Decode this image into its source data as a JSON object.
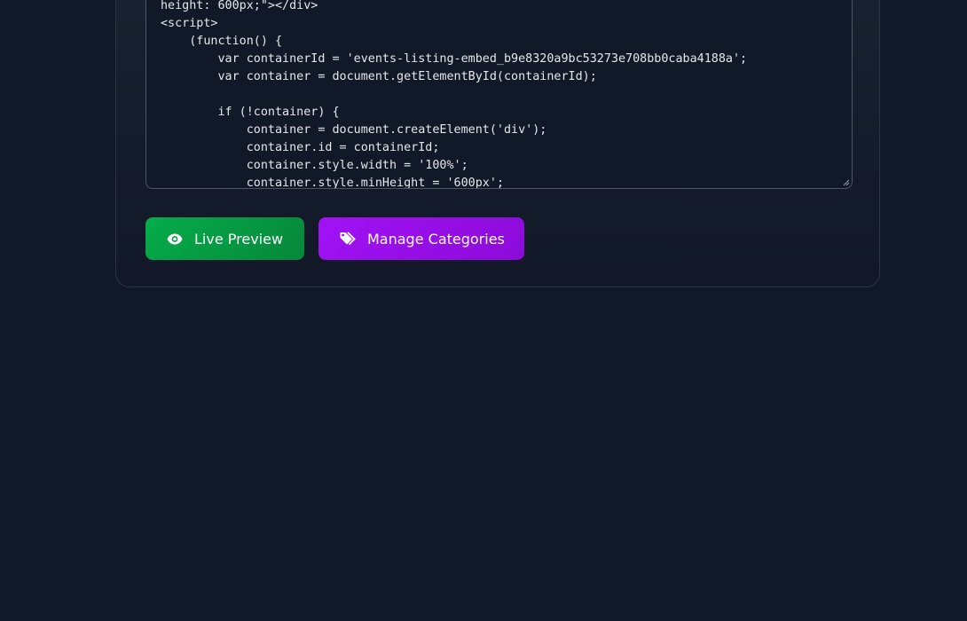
{
  "code_editor": {
    "lines": [
      "height: 600px;\"></div>",
      "<script>",
      "    (function() {",
      "        var containerId = 'events-listing-embed_b9e8320a9bc53273e708bb0caba4188a';",
      "        var container = document.getElementById(containerId);",
      "",
      "        if (!container) {",
      "            container = document.createElement('div');",
      "            container.id = containerId;",
      "            container.style.width = '100%';",
      "            container.style.minHeight = '600px';"
    ]
  },
  "actions": {
    "live_preview_label": "Live Preview",
    "live_preview_icon": "eye-icon",
    "live_preview_color": "#05ad4a",
    "manage_categories_label": "Manage Categories",
    "manage_categories_icon": "tags-icon",
    "manage_categories_color": "#a112f5"
  }
}
